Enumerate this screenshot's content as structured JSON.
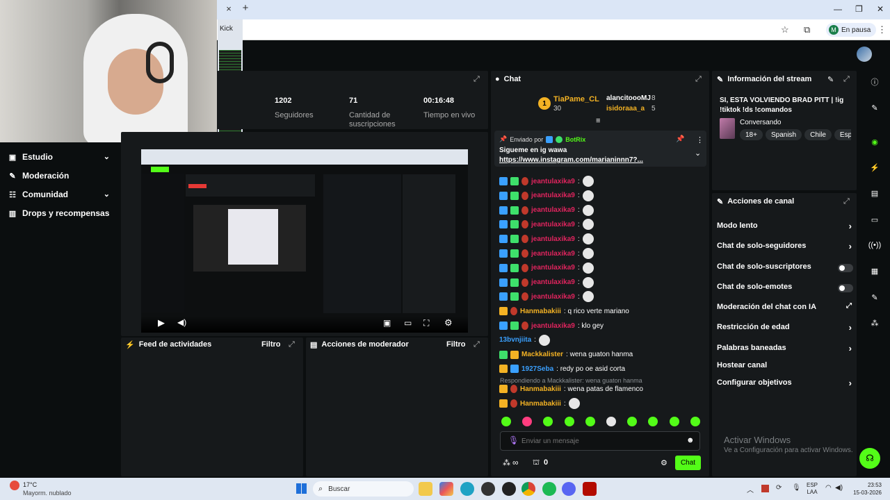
{
  "browser": {
    "tab_tooltip": "Kick",
    "close_glyph": "×",
    "new_tab_glyph": "+",
    "profile_initial": "M",
    "profile_status": "En pausa"
  },
  "sidebar": {
    "items": [
      {
        "label": "Estudio",
        "icon": "video-icon",
        "chevron": true
      },
      {
        "label": "Moderación",
        "icon": "wrench-icon",
        "chevron": false
      },
      {
        "label": "Comunidad",
        "icon": "users-icon",
        "chevron": true
      },
      {
        "label": "Drops y recompensas",
        "icon": "chart-icon",
        "chevron": false
      }
    ]
  },
  "stats": [
    {
      "value": "1202",
      "label": "Seguidores"
    },
    {
      "value": "71",
      "label": "Cantidad de suscripciones"
    },
    {
      "value": "00:16:48",
      "label": "Tiempo en vivo"
    }
  ],
  "feed": {
    "title": "Feed de actividades",
    "filter": "Filtro"
  },
  "modactions": {
    "title": "Acciones de moderador",
    "filter": "Filtro"
  },
  "chat": {
    "title": "Chat",
    "top_gifter": {
      "rank": "1",
      "name": "TiaPame_CL",
      "count": "30"
    },
    "gifters": [
      {
        "name": "alancitoooMJ",
        "count": "8"
      },
      {
        "name": "isidoraaa_a",
        "count": "5"
      }
    ],
    "pinned": {
      "prefix": "Enviado por",
      "sender": "BotRix",
      "text": "Sigueme en ig wawa",
      "link": "https://www.instagram.com/marianinnn7?..."
    },
    "messages": [
      {
        "user": "jeantulaxika9",
        "color": "#e0245e",
        "text": ":",
        "emote": true,
        "badges": [
          "blue",
          "green",
          "red"
        ]
      },
      {
        "user": "jeantulaxika9",
        "color": "#e0245e",
        "text": ":",
        "emote": true,
        "badges": [
          "blue",
          "green",
          "red"
        ]
      },
      {
        "user": "jeantulaxika9",
        "color": "#e0245e",
        "text": ":",
        "emote": true,
        "badges": [
          "blue",
          "green",
          "red"
        ]
      },
      {
        "user": "jeantulaxika9",
        "color": "#e0245e",
        "text": ":",
        "emote": true,
        "badges": [
          "blue",
          "green",
          "red"
        ]
      },
      {
        "user": "jeantulaxika9",
        "color": "#e0245e",
        "text": ":",
        "emote": true,
        "badges": [
          "blue",
          "green",
          "red"
        ]
      },
      {
        "user": "jeantulaxika9",
        "color": "#e0245e",
        "text": ":",
        "emote": true,
        "badges": [
          "blue",
          "green",
          "red"
        ]
      },
      {
        "user": "jeantulaxika9",
        "color": "#e0245e",
        "text": ":",
        "emote": true,
        "badges": [
          "blue",
          "green",
          "red"
        ]
      },
      {
        "user": "jeantulaxika9",
        "color": "#e0245e",
        "text": ":",
        "emote": true,
        "badges": [
          "blue",
          "green",
          "red"
        ]
      },
      {
        "user": "jeantulaxika9",
        "color": "#e0245e",
        "text": ":",
        "emote": true,
        "badges": [
          "blue",
          "green",
          "red"
        ]
      },
      {
        "user": "Hanmabakiii",
        "color": "#f3b224",
        "text": ": q rico verte mariano",
        "emote": false,
        "badges": [
          "gold",
          "red"
        ]
      },
      {
        "user": "jeantulaxika9",
        "color": "#e0245e",
        "text": ": klo gey",
        "emote": false,
        "badges": [
          "blue",
          "green",
          "red"
        ]
      },
      {
        "user": "13bvnjiita",
        "color": "#3aa0ff",
        "text": ":",
        "emote": true,
        "badges": []
      },
      {
        "user": "Mackkalister",
        "color": "#f3b224",
        "text": ": wena guaton hanma",
        "emote": false,
        "badges": [
          "green",
          "gold"
        ]
      },
      {
        "user": "1927Seba",
        "color": "#3aa0ff",
        "text": ": redy po oe asid corta",
        "emote": false,
        "badges": [
          "gold",
          "blue"
        ]
      }
    ],
    "reply_note": "Respondiendo a Mackkalister: wena guaton hanma",
    "reply_messages": [
      {
        "user": "Hanmabakiii",
        "color": "#f3b224",
        "text": ": wena patas de flamenco",
        "emote": false,
        "badges": [
          "gold",
          "red"
        ]
      },
      {
        "user": "Hanmabakiii",
        "color": "#f3b224",
        "text": ":",
        "emote": true,
        "badges": [
          "gold",
          "red"
        ]
      }
    ],
    "input_placeholder": "Enviar un mensaje",
    "infinity_label": "∞",
    "points": "0",
    "send_label": "Chat"
  },
  "stream_info": {
    "title_label": "Información del stream",
    "stream_title": "SI, ESTA VOLVIENDO BRAD PITT | !ig !tiktok !ds !comandos",
    "category": "Conversando",
    "tags": [
      "18+",
      "Spanish",
      "Chile",
      "Españo"
    ]
  },
  "channel_actions": {
    "title": "Acciones de canal",
    "rows": [
      {
        "label": "Modo lento",
        "kind": "arrow"
      },
      {
        "label": "Chat de solo-seguidores",
        "kind": "arrow"
      },
      {
        "label": "Chat de solo-suscriptores",
        "kind": "toggle"
      },
      {
        "label": "Chat de solo-emotes",
        "kind": "toggle"
      },
      {
        "label": "Moderación del chat con IA",
        "kind": "external"
      },
      {
        "label": "Restricción de edad",
        "kind": "arrow"
      },
      {
        "label": "Palabras baneadas",
        "kind": "arrow"
      },
      {
        "label": "Hostear canal",
        "kind": "none"
      },
      {
        "label": "Configurar objetivos",
        "kind": "arrow"
      }
    ]
  },
  "activate_windows": {
    "title": "Activar Windows",
    "subtitle": "Ve a Configuración para activar Windows."
  },
  "taskbar": {
    "weather_temp": "17°C",
    "weather_desc": "Mayorm. nublado",
    "search_placeholder": "Buscar",
    "lang_top": "ESP",
    "lang_bottom": "LAA",
    "time": "23:53",
    "date": "15-03-2026"
  },
  "colors": {
    "accent": "#53fc18",
    "panel": "#16191b",
    "background": "#0b0e0f"
  }
}
